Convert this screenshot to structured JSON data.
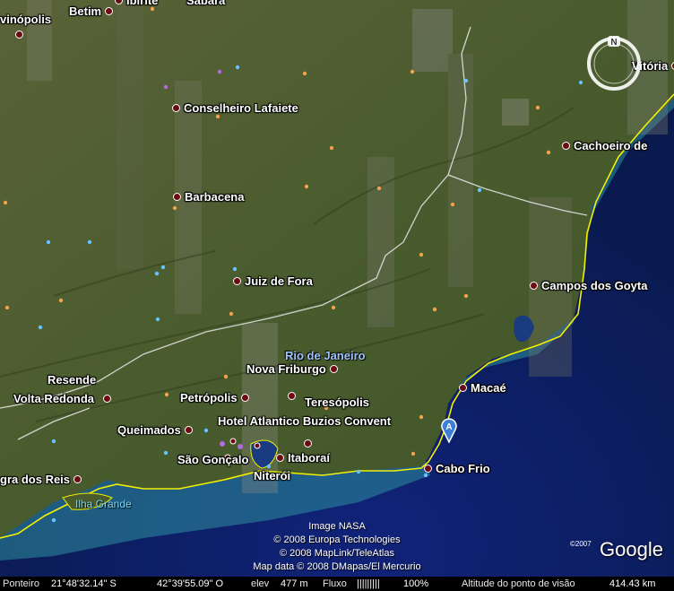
{
  "places": [
    {
      "id": "ipatinga-partial",
      "name": "vinópolis"
    },
    {
      "id": "betim",
      "name": "Betim"
    },
    {
      "id": "ibirite",
      "name": "Ibirité"
    },
    {
      "id": "sabara",
      "name": "Sabará"
    },
    {
      "id": "vitoria",
      "name": "Vitória"
    },
    {
      "id": "conselheiro-lafaiete",
      "name": "Conselheiro Lafaiete"
    },
    {
      "id": "cachoeiro",
      "name": "Cachoeiro de"
    },
    {
      "id": "barbacena",
      "name": "Barbacena"
    },
    {
      "id": "juiz-de-fora",
      "name": "Juiz de Fora"
    },
    {
      "id": "campos",
      "name": "Campos dos Goyta"
    },
    {
      "id": "nova-friburgo",
      "name": "Nova Friburgo"
    },
    {
      "id": "resende",
      "name": "Resende"
    },
    {
      "id": "volta-redonda",
      "name": "Volta Redonda"
    },
    {
      "id": "teresopolis",
      "name": "Teresópolis"
    },
    {
      "id": "macae",
      "name": "Macaé"
    },
    {
      "id": "petropolis",
      "name": "Petrópolis"
    },
    {
      "id": "queimados",
      "name": "Queimados"
    },
    {
      "id": "hotel-atlantico",
      "name": "Hotel Atlantico Buzios Convent"
    },
    {
      "id": "sao-goncalo",
      "name": "São Gonçalo"
    },
    {
      "id": "itaborai",
      "name": "Itaboraí"
    },
    {
      "id": "cabo-frio",
      "name": "Cabo Frio"
    },
    {
      "id": "angra",
      "name": "gra dos Reis"
    },
    {
      "id": "niteroi",
      "name": "Niterói"
    }
  ],
  "state_label": "Rio de Janeiro",
  "island_label": "Ilha Grande",
  "marker_letter": "A",
  "credits": [
    "Image NASA",
    "© 2008 Europa Technologies",
    "© 2008 MapLink/TeleAtlas",
    "Map data © 2008 DMapas/El Mercurio"
  ],
  "google_logo": "Google",
  "google_copyright": "©2007",
  "compass_north": "N",
  "status": {
    "pointer_label": "Ponteiro",
    "lat": "21°48'32.14\" S",
    "lon": "42°39'55.09\" O",
    "elev_label": "elev",
    "elev": "477 m",
    "stream_label": "Fluxo",
    "stream_bar": "|||||||||",
    "stream_pct": "100%",
    "eye_label": "Altitude do ponto de visão",
    "eye_alt": "414.43 km"
  },
  "colors": {
    "ocean": "#0b1b55",
    "land": "#4b5a32",
    "shelf": "#2d8fa0",
    "coastline": "#f5f000",
    "borders": "#d8d8d8",
    "city_dot": "#6b0a12",
    "marker": "#3d7fd6"
  }
}
